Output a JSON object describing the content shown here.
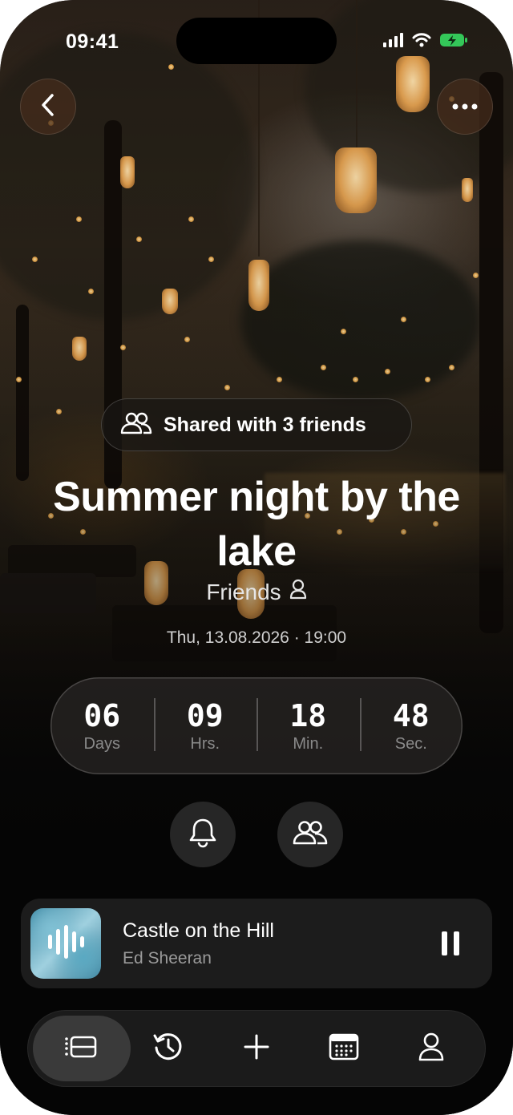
{
  "status_bar": {
    "time": "09:41"
  },
  "event": {
    "shared_label": "Shared with 3 friends",
    "title": "Summer night by the lake",
    "group": "Friends",
    "datetime": "Thu, 13.08.2026 · 19:00"
  },
  "countdown": [
    {
      "value": "06",
      "unit": "Days"
    },
    {
      "value": "09",
      "unit": "Hrs."
    },
    {
      "value": "18",
      "unit": "Min."
    },
    {
      "value": "48",
      "unit": "Sec."
    }
  ],
  "now_playing": {
    "song": "Castle on the Hill",
    "artist": "Ed Sheeran"
  },
  "icons": {
    "back": "chevron-left-icon",
    "more": "ellipsis-icon",
    "shared": "people-icon",
    "group": "person-icon",
    "reminder": "bell-icon",
    "participants": "people-icon",
    "tabs": [
      "list-icon",
      "history-icon",
      "plus-icon",
      "calendar-icon",
      "person-icon"
    ]
  },
  "colors": {
    "accent_battery": "#34c759",
    "background": "#050505"
  }
}
